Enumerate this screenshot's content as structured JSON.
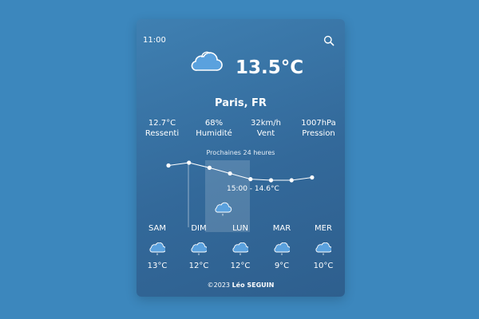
{
  "header": {
    "time": "11:00"
  },
  "current": {
    "temperature": "13.5°C",
    "city": "Paris, FR",
    "icon": "cloud-icon"
  },
  "stats": [
    {
      "value": "12.7°C",
      "label": "Ressenti"
    },
    {
      "value": "68%",
      "label": "Humidité"
    },
    {
      "value": "32km/h",
      "label": "Vent"
    },
    {
      "value": "1007hPa",
      "label": "Pression"
    }
  ],
  "hourly": {
    "title": "Prochaines 24 heures",
    "tooltip": "15:00 - 14.6°C",
    "tooltip_icon": "rain-cloud-icon"
  },
  "chart_data": {
    "type": "line",
    "y_unit": "°C",
    "highlight": {
      "x": "15:00",
      "y": 14.6
    },
    "values": [
      13.6,
      14.1,
      13.2,
      12.2,
      11.2,
      11.0,
      11.0,
      11.5
    ],
    "grid": false
  },
  "daily": [
    {
      "name": "SAM",
      "temp": "13°C"
    },
    {
      "name": "DIM",
      "temp": "12°C"
    },
    {
      "name": "LUN",
      "temp": "12°C"
    },
    {
      "name": "MAR",
      "temp": "9°C"
    },
    {
      "name": "MER",
      "temp": "10°C"
    }
  ],
  "footer": {
    "prefix": "©2023 ",
    "author": "Léo SEGUIN"
  },
  "colors": {
    "background": "#3c87bd",
    "card": "#33699a",
    "cloud": "#5aa1de"
  }
}
